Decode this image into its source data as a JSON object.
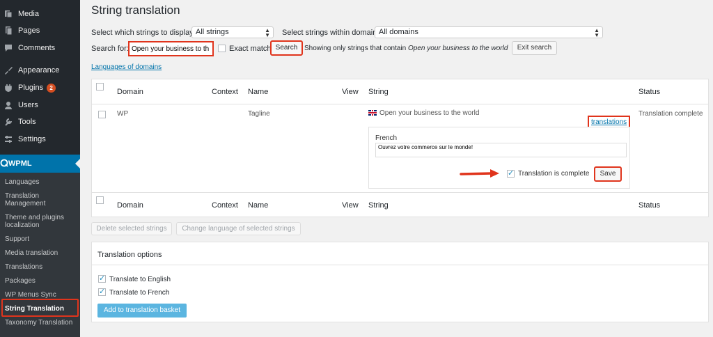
{
  "sidebar": {
    "items": [
      {
        "label": "Media",
        "icon": "media-icon"
      },
      {
        "label": "Pages",
        "icon": "pages-icon"
      },
      {
        "label": "Comments",
        "icon": "comments-icon"
      },
      {
        "label": "Appearance",
        "icon": "appearance-icon"
      },
      {
        "label": "Plugins",
        "icon": "plugins-icon",
        "badge": "2"
      },
      {
        "label": "Users",
        "icon": "users-icon"
      },
      {
        "label": "Tools",
        "icon": "tools-icon"
      },
      {
        "label": "Settings",
        "icon": "settings-icon"
      }
    ],
    "wpml_label": "WPML",
    "submenu": [
      "Languages",
      "Translation Management",
      "Theme and plugins localization",
      "Support",
      "Media translation",
      "Translations",
      "Packages",
      "WP Menus Sync",
      "String Translation",
      "Taxonomy Translation"
    ]
  },
  "page": {
    "title": "String translation",
    "filter_display_label": "Select which strings to display:",
    "filter_display_value": "All strings",
    "filter_domain_label": "Select strings within domain:",
    "filter_domain_value": "All domains",
    "search_label": "Search for:",
    "search_value": "Open your business to th",
    "exact_match_label": "Exact match",
    "search_button": "Search",
    "showing_prefix": "Showing only strings that contain",
    "showing_query": "Open your business to the world",
    "exit_search_button": "Exit search",
    "languages_link": "Languages of domains"
  },
  "table": {
    "headers": {
      "domain": "Domain",
      "context": "Context",
      "name": "Name",
      "view": "View",
      "string": "String",
      "status": "Status"
    },
    "row": {
      "domain": "WP",
      "context": "",
      "name": "Tagline",
      "string": "Open your business to the world",
      "translations_link": "translations",
      "status": "Translation complete",
      "translation_language": "French",
      "translation_text": "Ouvrez votre commerce sur le monde!",
      "complete_label": "Translation is complete",
      "save_button": "Save"
    }
  },
  "bulk": {
    "delete_button": "Delete selected strings",
    "change_lang_button": "Change language of selected strings"
  },
  "options": {
    "title": "Translation options",
    "opt1": "Translate to English",
    "opt2": "Translate to French",
    "basket_button": "Add to translation basket"
  },
  "colors": {
    "sidebar_bg": "#23282d",
    "accent": "#0073aa",
    "highlight": "#e0341c",
    "badge": "#d54e21"
  }
}
